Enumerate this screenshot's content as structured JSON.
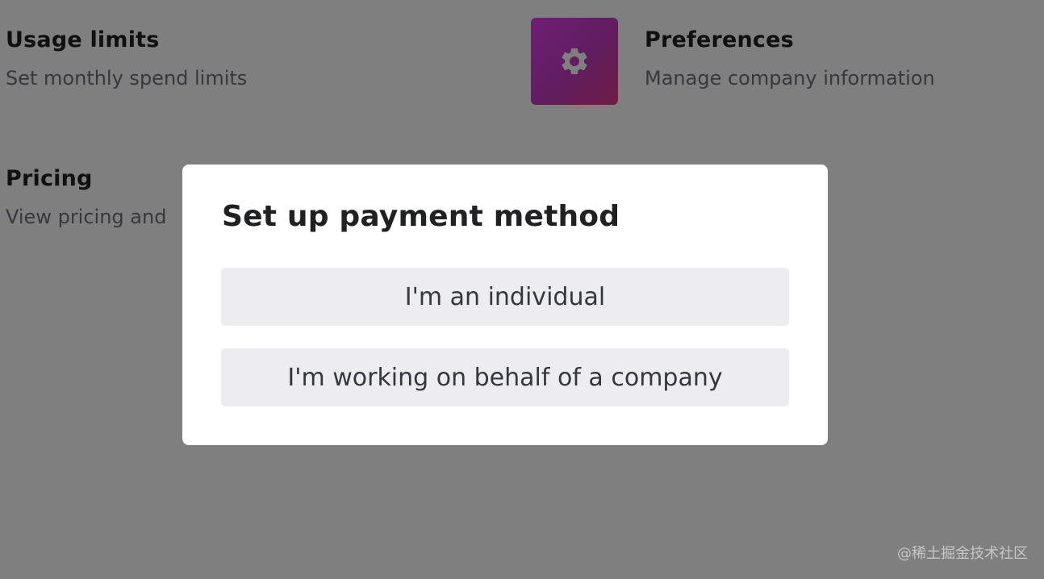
{
  "background": {
    "cards": [
      {
        "title": "Usage limits",
        "description": "Set monthly spend limits"
      },
      {
        "title": "Preferences",
        "description": "Manage company information",
        "icon": "gear-icon"
      },
      {
        "title": "Pricing",
        "description": "View pricing and"
      }
    ],
    "accent_color": "#dd3fe9"
  },
  "modal": {
    "title": "Set up payment method",
    "options": [
      {
        "label": "I'm an individual"
      },
      {
        "label": "I'm working on behalf of a company"
      }
    ]
  },
  "watermark": "@稀土掘金技术社区"
}
